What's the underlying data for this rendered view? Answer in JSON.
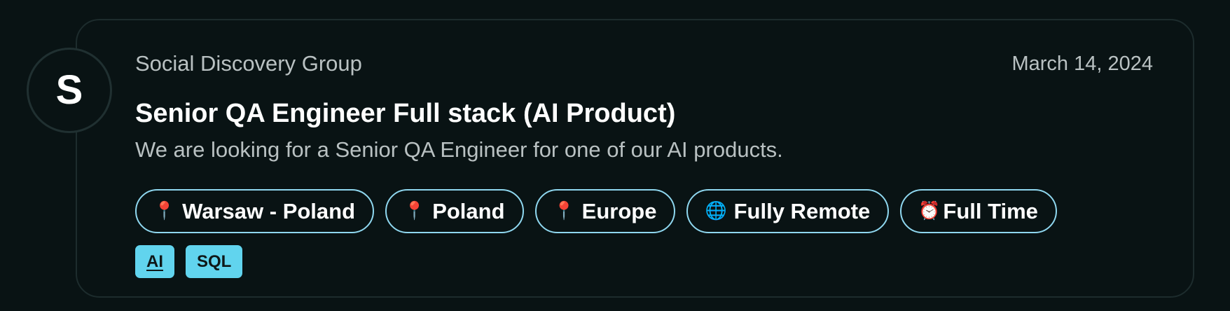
{
  "card": {
    "avatar_initial": "S",
    "company": "Social Discovery Group",
    "date": "March 14, 2024",
    "title": "Senior QA Engineer Full stack (AI Product)",
    "description": "We are looking for a Senior QA Engineer for one of our AI products.",
    "locations": [
      {
        "icon": "pin-icon",
        "label": "Warsaw - Poland"
      },
      {
        "icon": "pin-icon",
        "label": "Poland"
      },
      {
        "icon": "pin-icon",
        "label": "Europe"
      },
      {
        "icon": "globe-icon",
        "label": "Fully Remote"
      },
      {
        "icon": "alarm-clock-icon",
        "label": "Full Time"
      }
    ],
    "skills": [
      {
        "label": "AI"
      },
      {
        "label": "SQL"
      }
    ]
  },
  "colors": {
    "background": "#091314",
    "card_border": "#1d2c2d",
    "pill_border": "#8fd7ef",
    "skill_tag_bg": "#61d4ee",
    "muted_text": "#b9c1c2"
  }
}
